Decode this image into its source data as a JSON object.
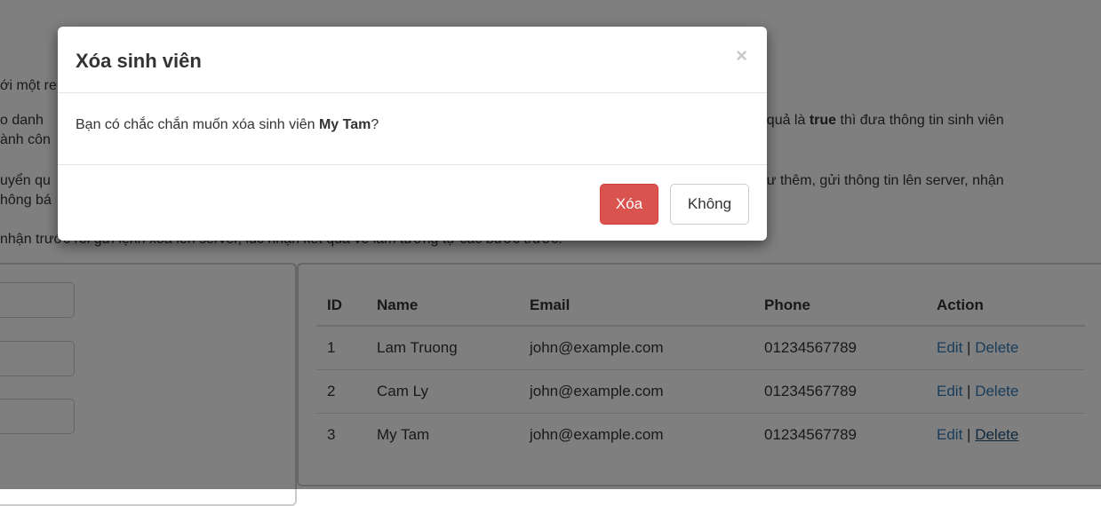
{
  "background": {
    "para1": "ới một re",
    "para2_line1": "o danh",
    "para2_line1_right_pre": "ết quả là ",
    "para2_line1_right_bold": "true",
    "para2_line1_right_post": " thì đưa thông tin sinh viên",
    "para2_line2": "ành côn",
    "para3_line1": "uyển qu",
    "para3_line1_right": "như thêm, gửi thông tin lên server, nhận",
    "para3_line2": "hông bá",
    "para4": "nhận trước rồi gửi lệnh xóa lên server, lúc nhận kết quả về làm tương tự các bước trước."
  },
  "table": {
    "headers": [
      "ID",
      "Name",
      "Email",
      "Phone",
      "Action"
    ],
    "rows": [
      {
        "id": "1",
        "name": "Lam Truong",
        "email": "john@example.com",
        "phone": "01234567789",
        "edit": "Edit",
        "sep": "|",
        "delete": "Delete"
      },
      {
        "id": "2",
        "name": "Cam Ly",
        "email": "john@example.com",
        "phone": "01234567789",
        "edit": "Edit",
        "sep": "|",
        "delete": "Delete"
      },
      {
        "id": "3",
        "name": "My Tam",
        "email": "john@example.com",
        "phone": "01234567789",
        "edit": "Edit",
        "sep": "|",
        "delete": "Delete"
      }
    ]
  },
  "modal": {
    "title": "Xóa sinh viên",
    "close_symbol": "×",
    "message_pre": "Bạn có chắc chắn muốn xóa sinh viên ",
    "message_name": "My Tam",
    "message_post": "?",
    "confirm_label": "Xóa",
    "cancel_label": "Không"
  },
  "colors": {
    "danger": "#d9534f",
    "link": "#337ab7"
  }
}
